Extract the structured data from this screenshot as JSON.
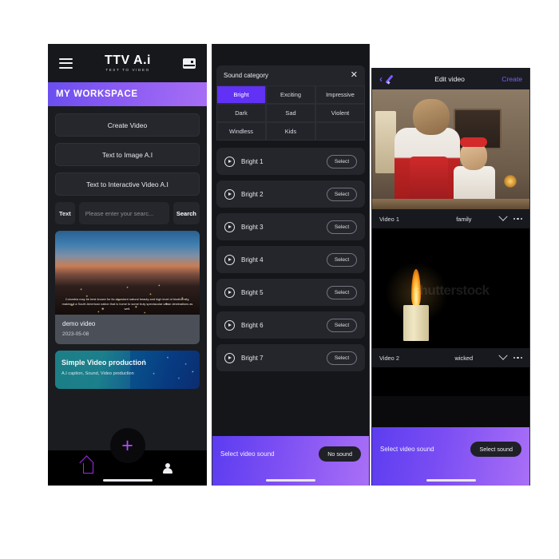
{
  "colors": {
    "accent_purple": "#6131f5",
    "brand_violet": "#7f5cf7",
    "panel_dark": "#1b1c20",
    "card_dark": "#24262c"
  },
  "panel1": {
    "topbar": {
      "menu_icon": "hamburger-icon",
      "brand_main": "TTV A.i",
      "brand_sub": "TEXT TO VIDEO",
      "wallet_icon": "wallet-icon"
    },
    "hero_title": "MY WORKSPACE",
    "buttons": [
      {
        "label": "Create Video"
      },
      {
        "label": "Text to Image A.I"
      },
      {
        "label": "Text to Interactive Video A.I"
      }
    ],
    "search": {
      "tag_label": "Text",
      "placeholder": "Please enter your searc...",
      "button_label": "Search"
    },
    "video_card": {
      "thumb_caption": "Colombia may be best known for its abundant natural beauty and high level of biodiversity, making it a South American nation that is home to some truly spectacular urban destinations as well.",
      "title": "demo video",
      "date": "2023-05-08"
    },
    "promo_card": {
      "title": "Simple Video production",
      "subtitle": "A.I caption, Sound, Video production"
    },
    "fab": {
      "icon": "plus-icon"
    },
    "tabbar": [
      {
        "icon": "home-icon",
        "name": "home"
      },
      {
        "icon": "person-icon",
        "name": "profile"
      }
    ]
  },
  "panel2": {
    "header": {
      "title": "Sound category",
      "close_icon": "close-icon"
    },
    "categories": [
      {
        "label": "Bright",
        "active": true
      },
      {
        "label": "Exciting",
        "active": false
      },
      {
        "label": "Impressive",
        "active": false
      },
      {
        "label": "Dark",
        "active": false
      },
      {
        "label": "Sad",
        "active": false
      },
      {
        "label": "Violent",
        "active": false
      },
      {
        "label": "Windless",
        "active": false
      },
      {
        "label": "Kids",
        "active": false
      },
      {
        "label": "",
        "active": false
      }
    ],
    "sounds": [
      {
        "name": "Bright 1",
        "action": "Select"
      },
      {
        "name": "Bright 2",
        "action": "Select"
      },
      {
        "name": "Bright 3",
        "action": "Select"
      },
      {
        "name": "Bright 4",
        "action": "Select"
      },
      {
        "name": "Bright 5",
        "action": "Select"
      },
      {
        "name": "Bright 6",
        "action": "Select"
      },
      {
        "name": "Bright 7",
        "action": "Select"
      }
    ],
    "bottom": {
      "label": "Select video sound",
      "button": "No sound"
    }
  },
  "panel3": {
    "topbar": {
      "back_icon": "chevron-left-icon",
      "edit_icon": "pencil-icon",
      "title": "Edit video",
      "create_label": "Create"
    },
    "clips": [
      {
        "label": "Video 1",
        "tag": "family",
        "chevron": "chevron-down-icon",
        "more": "more-icon"
      },
      {
        "label": "Video 2",
        "tag": "wicked",
        "chevron": "chevron-down-icon",
        "more": "more-icon",
        "watermark": "shutterstock"
      }
    ],
    "bottom": {
      "label": "Select video sound",
      "button": "Select sound"
    }
  }
}
